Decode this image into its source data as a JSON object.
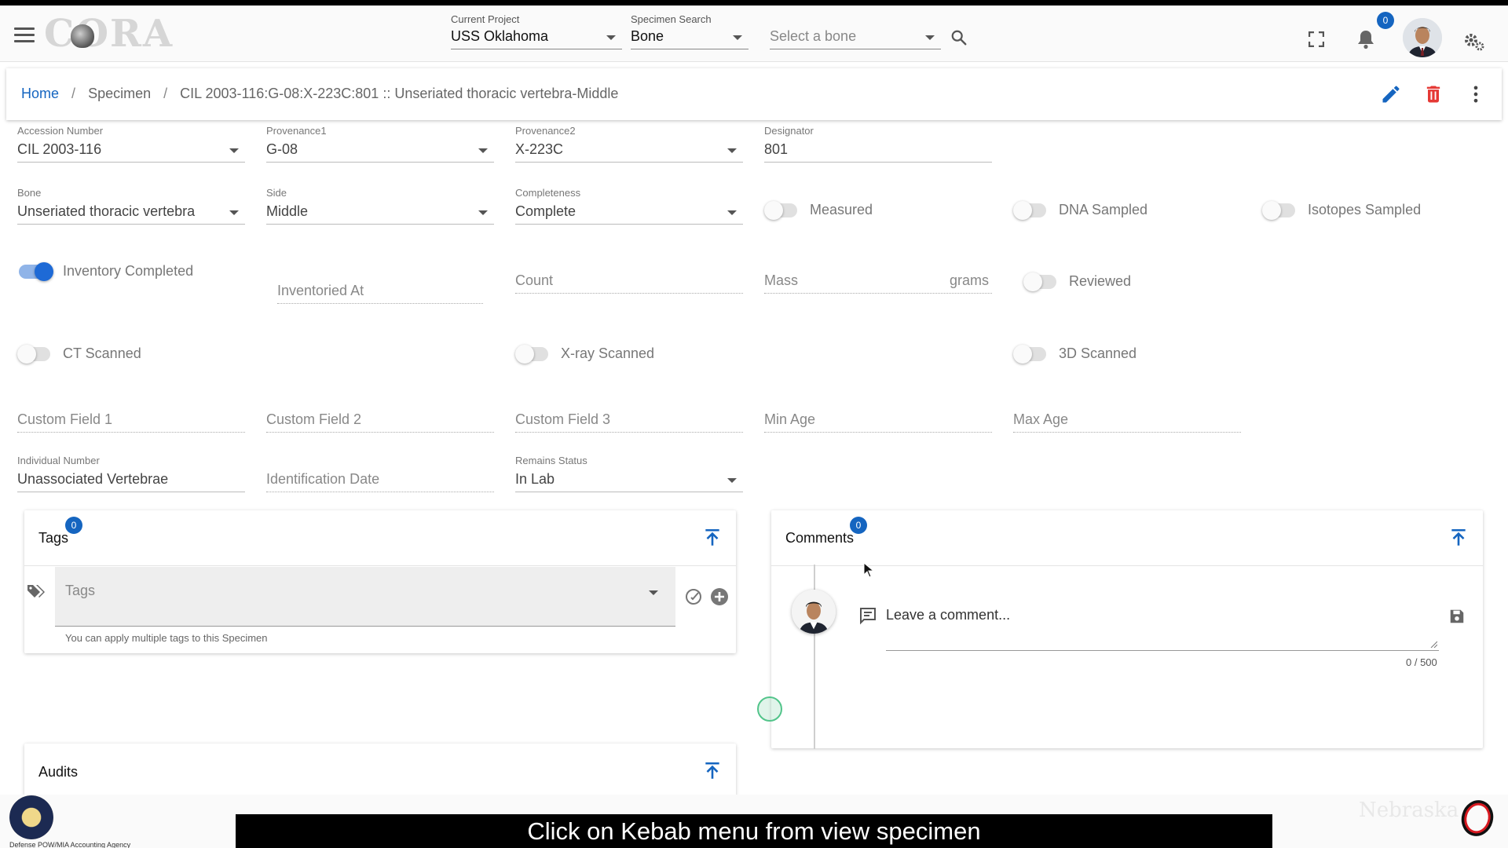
{
  "toolbar": {
    "logo_text": "CORA",
    "project": {
      "label": "Current Project",
      "value": "USS Oklahoma"
    },
    "specimen_search": {
      "label": "Specimen Search",
      "value": "Bone"
    },
    "bone_select": {
      "placeholder": "Select a bone"
    },
    "notification_count": "0",
    "icons": [
      "menu-icon",
      "search-icon",
      "fullscreen-icon",
      "bell-icon",
      "settings-icon"
    ]
  },
  "breadcrumb": {
    "home": "Home",
    "specimen": "Specimen",
    "current": "CIL 2003-116:G-08:X-223C:801 :: Unseriated thoracic vertebra-Middle",
    "separator": "/"
  },
  "colors": {
    "primary": "#1565c0",
    "delete": "#e53935",
    "toggle_on": "#1e6ad6"
  },
  "form": {
    "accession": {
      "label": "Accession Number",
      "value": "CIL 2003-116"
    },
    "provenance1": {
      "label": "Provenance1",
      "value": "G-08"
    },
    "provenance2": {
      "label": "Provenance2",
      "value": "X-223C"
    },
    "designator": {
      "label": "Designator",
      "value": "801"
    },
    "bone": {
      "label": "Bone",
      "value": "Unseriated thoracic vertebra"
    },
    "side": {
      "label": "Side",
      "value": "Middle"
    },
    "completeness": {
      "label": "Completeness",
      "value": "Complete"
    },
    "measured": {
      "label": "Measured",
      "on": false
    },
    "dna_sampled": {
      "label": "DNA Sampled",
      "on": false
    },
    "isotopes_sampled": {
      "label": "Isotopes Sampled",
      "on": false
    },
    "inventory_completed": {
      "label": "Inventory Completed",
      "on": true
    },
    "inventoried_at": {
      "placeholder": "Inventoried At"
    },
    "count": {
      "placeholder": "Count"
    },
    "mass": {
      "placeholder": "Mass",
      "suffix": "grams"
    },
    "reviewed": {
      "label": "Reviewed",
      "on": false
    },
    "ct_scanned": {
      "label": "CT Scanned",
      "on": false
    },
    "xray_scanned": {
      "label": "X-ray Scanned",
      "on": false
    },
    "scanned_3d": {
      "label": "3D Scanned",
      "on": false
    },
    "custom1": {
      "placeholder": "Custom Field 1"
    },
    "custom2": {
      "placeholder": "Custom Field 2"
    },
    "custom3": {
      "placeholder": "Custom Field 3"
    },
    "min_age": {
      "placeholder": "Min Age"
    },
    "max_age": {
      "placeholder": "Max Age"
    },
    "individual_number": {
      "label": "Individual Number",
      "value": "Unassociated Vertebrae"
    },
    "identification_date": {
      "placeholder": "Identification Date"
    },
    "remains_status": {
      "label": "Remains Status",
      "value": "In Lab"
    }
  },
  "tags_card": {
    "title": "Tags",
    "count": "0",
    "placeholder": "Tags",
    "hint": "You can apply multiple tags to this Specimen"
  },
  "comments_card": {
    "title": "Comments",
    "count": "0",
    "placeholder": "Leave a comment...",
    "counter": "0 / 500"
  },
  "audits_card": {
    "title": "Audits"
  },
  "footer": {
    "agency": "Defense POW/MIA Accounting Agency",
    "university": "Nebraska",
    "caption": "Click on Kebab menu from view specimen"
  }
}
